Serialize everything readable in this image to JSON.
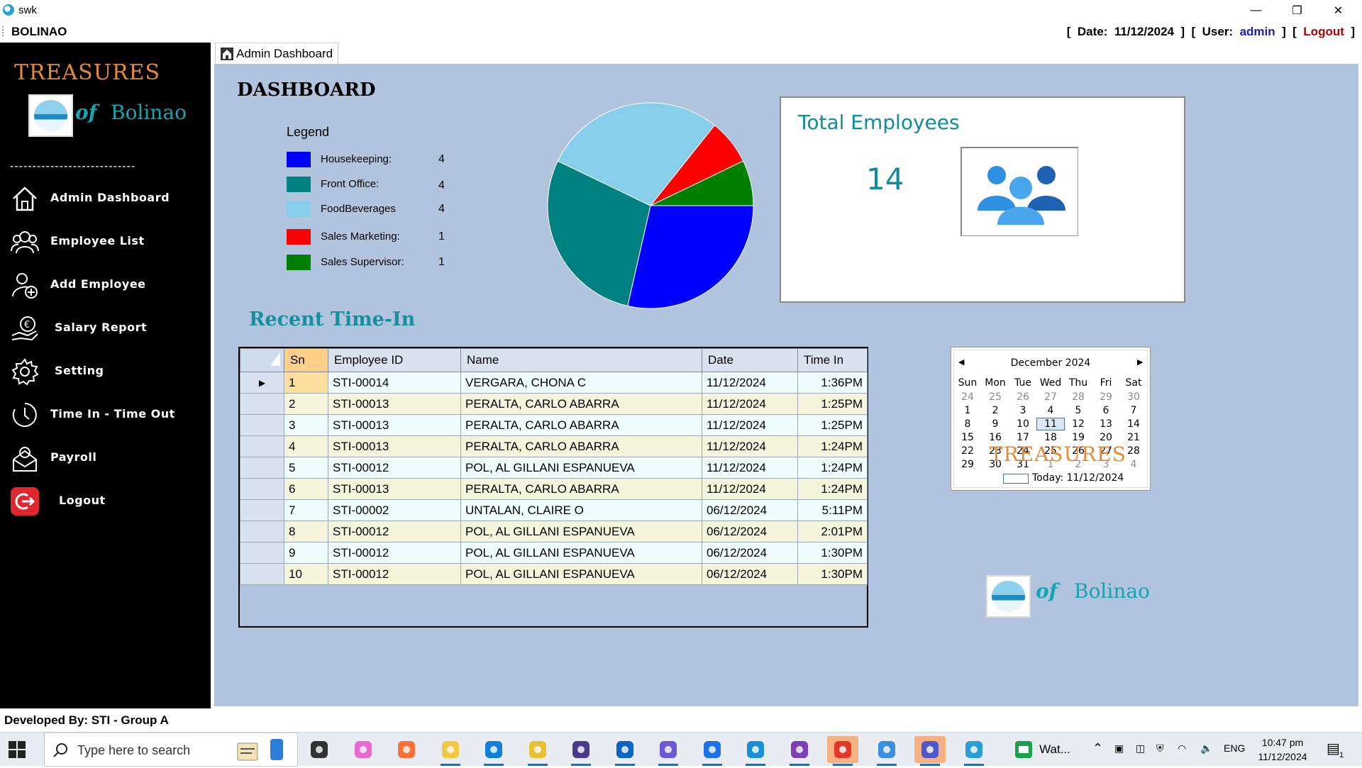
{
  "window": {
    "title": "swk",
    "minimize": "—",
    "restore": "❐",
    "close": "✕"
  },
  "menubar": {
    "brand": "BOLINAO",
    "date_prefix": "[  Date:  ",
    "date": "11/12/2024",
    "user_prefix": "  ]  [  User:  ",
    "user": "admin",
    "logout_prefix": "  ]  [  ",
    "logout": "Logout",
    "suffix": "  ]"
  },
  "sidebar": {
    "logo_word": "TREASURES",
    "logo_of": "of",
    "logo_place": "Bolinao",
    "separator": "----------------------------",
    "items": [
      {
        "label": "Admin Dashboard",
        "icon": "home-icon"
      },
      {
        "label": "Employee List",
        "icon": "users-icon"
      },
      {
        "label": "Add Employee",
        "icon": "add-user-icon"
      },
      {
        "label": "Salary Report",
        "icon": "salary-hand-icon"
      },
      {
        "label": "Setting",
        "icon": "gear-icon"
      },
      {
        "label": "Time In - Time Out",
        "icon": "clock-icon"
      },
      {
        "label": "Payroll",
        "icon": "payroll-icon"
      },
      {
        "label": "Logout",
        "icon": "logout-icon"
      }
    ]
  },
  "tabs": [
    {
      "label": "Admin Dashboard",
      "icon": "home-icon"
    }
  ],
  "dashboard": {
    "heading": "DASHBOARD",
    "legend_title": "Legend",
    "colors": {
      "housekeeping": "#0000ff",
      "front_office": "#008080",
      "food_beverages": "#87ceeb",
      "sales_marketing": "#ff0000",
      "sales_supervisor": "#008000"
    }
  },
  "chart_data": {
    "type": "pie",
    "categories": [
      "Housekeeping:",
      "Front Office:",
      "FoodBeverages",
      "Sales Marketing:",
      "Sales Supervisor:"
    ],
    "values": [
      4,
      4,
      4,
      1,
      1
    ],
    "colors": [
      "#0000ff",
      "#008080",
      "#87ceeb",
      "#ff0000",
      "#008000"
    ]
  },
  "total_employees": {
    "title": "Total Employees",
    "count": "14",
    "icon": "people-group-icon"
  },
  "recent": {
    "heading": "Recent Time-In",
    "columns": [
      "Sn",
      "Employee ID",
      "Name",
      "Date",
      "Time In"
    ],
    "rows": [
      [
        "1",
        "STI-00014",
        "VERGARA, CHONA C",
        "11/12/2024",
        "1:36PM"
      ],
      [
        "2",
        "STI-00013",
        "PERALTA, CARLO ABARRA",
        "11/12/2024",
        "1:25PM"
      ],
      [
        "3",
        "STI-00013",
        "PERALTA, CARLO ABARRA",
        "11/12/2024",
        "1:25PM"
      ],
      [
        "4",
        "STI-00013",
        "PERALTA, CARLO ABARRA",
        "11/12/2024",
        "1:24PM"
      ],
      [
        "5",
        "STI-00012",
        "POL, AL GILLANI ESPANUEVA",
        "11/12/2024",
        "1:24PM"
      ],
      [
        "6",
        "STI-00013",
        "PERALTA, CARLO ABARRA",
        "11/12/2024",
        "1:24PM"
      ],
      [
        "7",
        "STI-00002",
        "UNTALAN, CLAIRE O",
        "06/12/2024",
        "5:11PM"
      ],
      [
        "8",
        "STI-00012",
        "POL, AL GILLANI ESPANUEVA",
        "06/12/2024",
        "2:01PM"
      ],
      [
        "9",
        "STI-00012",
        "POL, AL GILLANI ESPANUEVA",
        "06/12/2024",
        "1:30PM"
      ],
      [
        "10",
        "STI-00012",
        "POL, AL GILLANI ESPANUEVA",
        "06/12/2024",
        "1:30PM"
      ]
    ]
  },
  "calendar": {
    "month": "December 2024",
    "days_of_week": [
      "Sun",
      "Mon",
      "Tue",
      "Wed",
      "Thu",
      "Fri",
      "Sat"
    ],
    "weeks": [
      [
        "24",
        "25",
        "26",
        "27",
        "28",
        "29",
        "30"
      ],
      [
        "1",
        "2",
        "3",
        "4",
        "5",
        "6",
        "7"
      ],
      [
        "8",
        "9",
        "10",
        "11",
        "12",
        "13",
        "14"
      ],
      [
        "15",
        "16",
        "17",
        "18",
        "19",
        "20",
        "21"
      ],
      [
        "22",
        "23",
        "24",
        "25",
        "26",
        "27",
        "28"
      ],
      [
        "29",
        "30",
        "31",
        "1",
        "2",
        "3",
        "4"
      ]
    ],
    "selected": "11",
    "today_label": "Today: 11/12/2024"
  },
  "footer": {
    "developer": "Developed By: STI - Group A"
  },
  "taskbar": {
    "search_placeholder": "Type here to search",
    "apps": [
      "task-view-icon",
      "copilot-icon",
      "firefox-icon",
      "file-explorer-icon",
      "edge-icon",
      "snipping-icon",
      "jw-icon",
      "outlook-icon",
      "app-icon",
      "chrome-profile-icon",
      "box-icon",
      "visual-studio-icon",
      "chrome-icon",
      "app-folder-icon",
      "teams-icon",
      "swk-app-icon"
    ],
    "whatsapp_label": "Wat...",
    "lang": "ENG",
    "time": "10:47 pm",
    "date": "11/12/2024",
    "notification_count": "1"
  }
}
